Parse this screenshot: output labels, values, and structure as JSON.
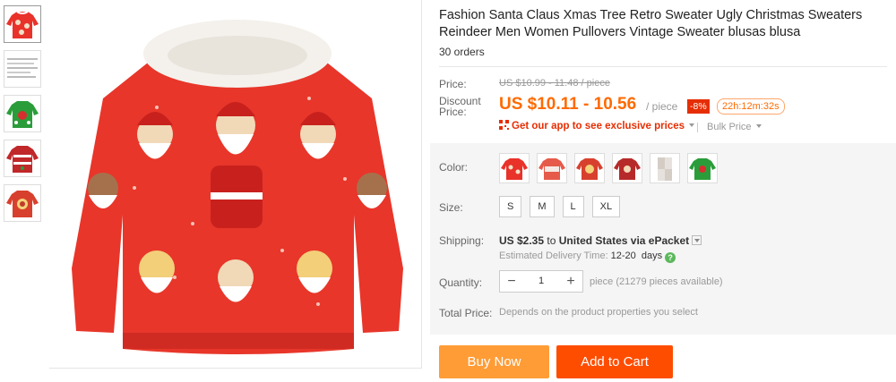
{
  "product": {
    "title": "Fashion Santa Claus Xmas Tree Retro Sweater Ugly Christmas Sweaters Reindeer Men Women Pullovers Vintage Sweater blusas blusa",
    "orders": "30 orders"
  },
  "thumbnails": [
    {
      "icon": "santa-red-sweater-thumb"
    },
    {
      "icon": "size-chart-thumb"
    },
    {
      "icon": "green-xmas-sweater-thumb"
    },
    {
      "icon": "red-pattern-sweater-thumb"
    },
    {
      "icon": "red-print-sweater-thumb"
    }
  ],
  "price": {
    "label": "Price:",
    "original": "US $10.99 - 11.48 / piece",
    "discount_label_1": "Discount",
    "discount_label_2": "Price:",
    "current": "US $10.11 - 10.56",
    "unit": "/ piece",
    "discount_badge": "-8%",
    "countdown": "22h:12m:32s",
    "app_link": "Get our app to see exclusive prices",
    "bulk_price": "Bulk Price"
  },
  "color": {
    "label": "Color:",
    "swatch_count": 6
  },
  "size": {
    "label": "Size:",
    "options": [
      "S",
      "M",
      "L",
      "XL"
    ]
  },
  "shipping": {
    "label": "Shipping:",
    "cost": "US $2.35",
    "to": "to",
    "destination": "United States via ePacket",
    "delivery_label": "Estimated Delivery Time:",
    "delivery_value": "12-20",
    "delivery_unit": "days"
  },
  "quantity": {
    "label": "Quantity:",
    "minus": "−",
    "value": "1",
    "plus": "+",
    "available": "piece (21279 pieces available)"
  },
  "total": {
    "label": "Total Price:",
    "note": "Depends on the product properties you select"
  },
  "actions": {
    "buy_now": "Buy Now",
    "add_to_cart": "Add to Cart"
  },
  "colors": {
    "accent_orange": "#ff6a00",
    "buy_button": "#ff9c36",
    "cart_button": "#ff4d00",
    "badge_red": "#e62e04"
  }
}
